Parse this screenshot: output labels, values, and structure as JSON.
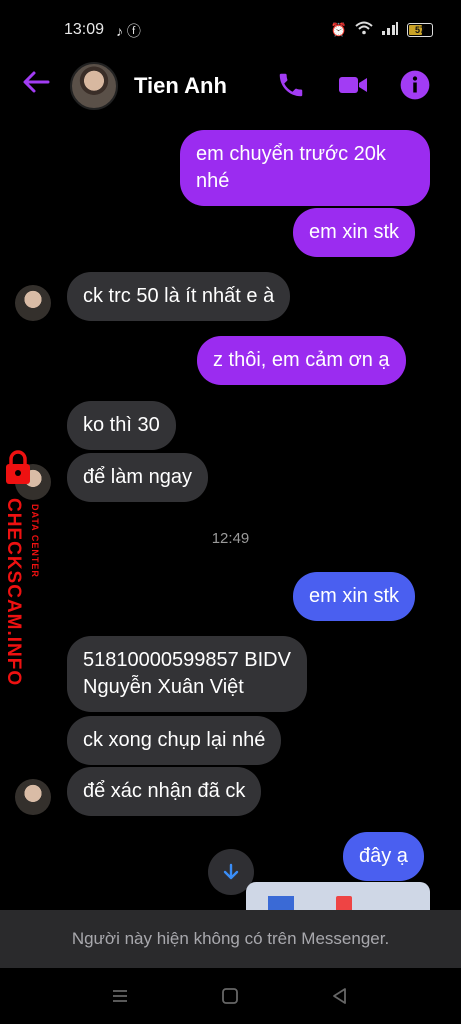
{
  "status_bar": {
    "time": "13:09",
    "battery": "57"
  },
  "header": {
    "contact_name": "Tien Anh"
  },
  "colors": {
    "accent": "#9b2cf0",
    "outgoing_blue": "#4a5ff0",
    "incoming": "#333336",
    "watermark": "#e11"
  },
  "messages": [
    {
      "text": "em chuyển trước 20k nhé"
    },
    {
      "text": "em xin stk"
    },
    {
      "text": "ck trc 50 là ít nhất e à"
    },
    {
      "text": "z thôi, em cảm ơn ạ"
    },
    {
      "text": "ko thì 30"
    },
    {
      "text": "để làm ngay"
    },
    {
      "text": "em xin stk"
    },
    {
      "text": "51810000599857 BIDV\nNguyễn Xuân Việt"
    },
    {
      "text": "ck xong chụp lại nhé"
    },
    {
      "text": "để xác nhận đã ck"
    },
    {
      "text": "đây ạ"
    }
  ],
  "timestamp": "12:49",
  "notice": "Người này hiện không có trên Messenger.",
  "watermark": {
    "brand": "CHECKSCAM.INFO",
    "sub": "DATA CENTER"
  },
  "icons": [
    "back-arrow-icon",
    "phone-icon",
    "video-icon",
    "info-icon",
    "scroll-down-icon",
    "menu-icon",
    "home-icon",
    "back-icon"
  ]
}
